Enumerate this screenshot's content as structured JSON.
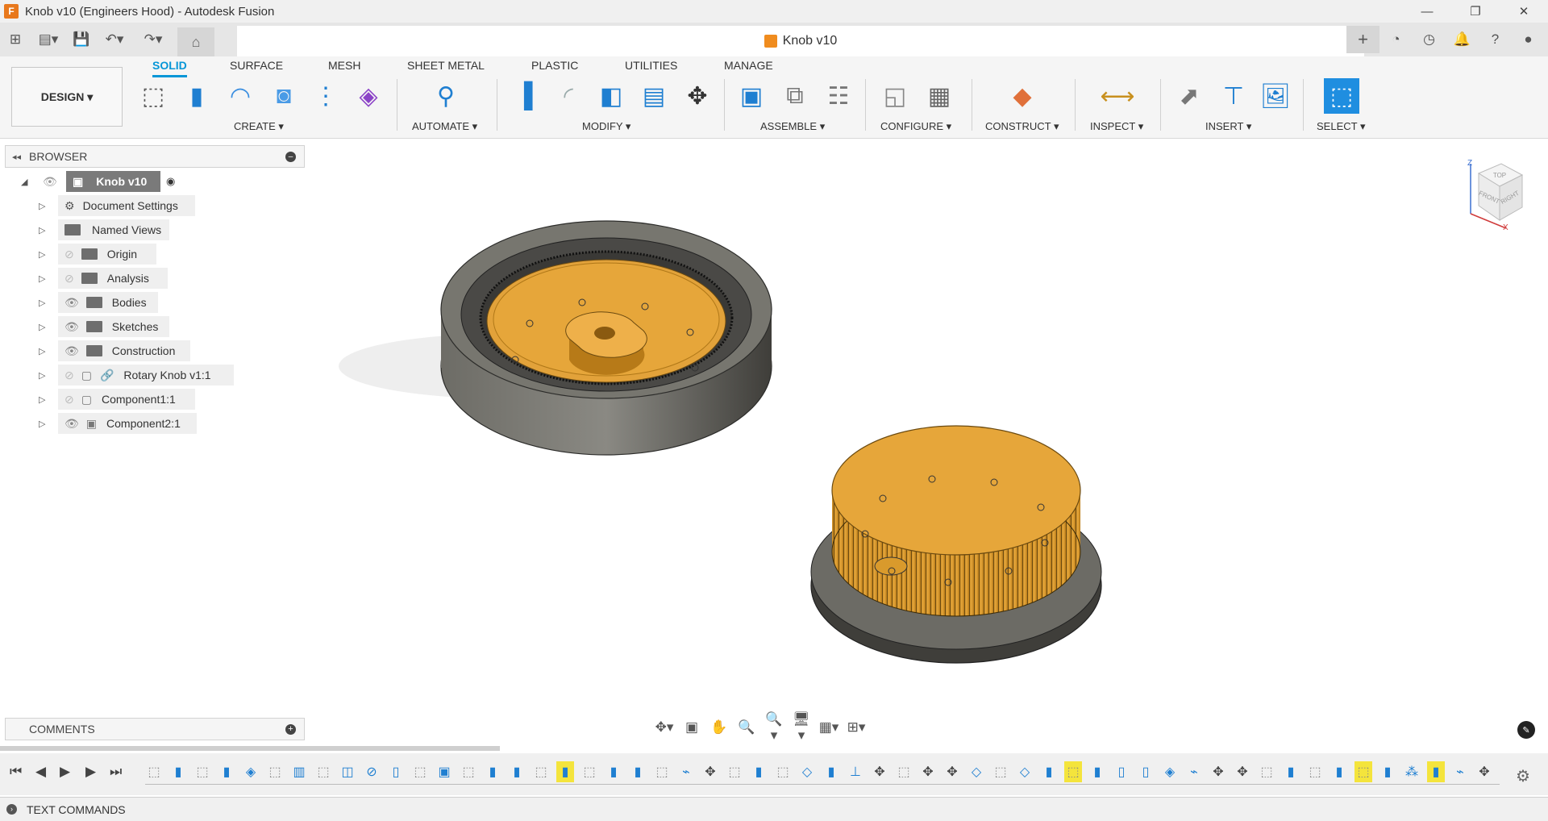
{
  "window": {
    "title": "Knob v10 (Engineers Hood) - Autodesk Fusion",
    "app_icon": "F"
  },
  "document_tab": {
    "title": "Knob v10"
  },
  "workspace_button": "DESIGN ▾",
  "workspace_tabs": [
    "SOLID",
    "SURFACE",
    "MESH",
    "SHEET METAL",
    "PLASTIC",
    "UTILITIES",
    "MANAGE"
  ],
  "tool_groups": [
    "CREATE ▾",
    "AUTOMATE ▾",
    "MODIFY ▾",
    "ASSEMBLE ▾",
    "CONFIGURE ▾",
    "CONSTRUCT ▾",
    "INSPECT ▾",
    "INSERT ▾",
    "SELECT ▾"
  ],
  "browser": {
    "title": "BROWSER",
    "root": "Knob v10",
    "items": [
      "Document Settings",
      "Named Views",
      "Origin",
      "Analysis",
      "Bodies",
      "Sketches",
      "Construction",
      "Rotary Knob v1:1",
      "Component1:1",
      "Component2:1"
    ]
  },
  "comments": {
    "title": "COMMENTS"
  },
  "viewcube": {
    "top": "TOP",
    "front": "FRONT",
    "right": "RIGHT",
    "z": "Z",
    "x": "X"
  },
  "text_commands": {
    "title": "TEXT COMMANDS"
  },
  "colors": {
    "accent": "#0696d7",
    "part_orange": "#e6a032",
    "part_gray": "#5e5d58",
    "highlight": "#f4e43c"
  },
  "icons": {
    "timeline_highlight": "yellow-highlight"
  }
}
